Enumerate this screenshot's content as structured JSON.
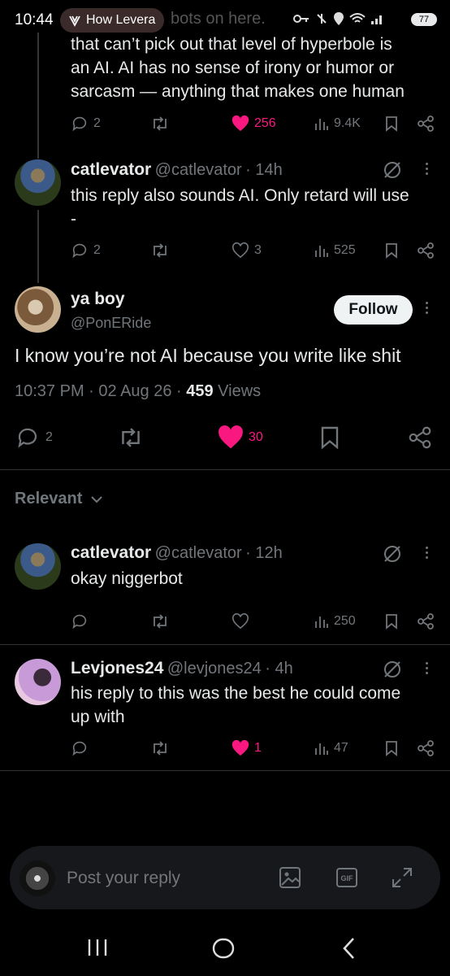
{
  "statusbar": {
    "time": "10:44",
    "app_pill": "How Levera",
    "notif_text": "bots on here.",
    "battery": "77"
  },
  "prev_tweet": {
    "text_lines": [
      "that can’t pick out that level of hyperbole is",
      "an AI. AI has no sense of irony or humor or",
      "sarcasm — anything that makes one human"
    ],
    "replies": "2",
    "likes": "256",
    "views": "9.4K"
  },
  "reply1": {
    "name": "catlevator",
    "handle": "@catlevator",
    "time": "14h",
    "text_lines": [
      "this reply also sounds AI. Only retard will use",
      "-"
    ],
    "replies": "2",
    "likes": "3",
    "views": "525"
  },
  "main": {
    "name": "ya boy",
    "handle": "@PonERide",
    "follow_label": "Follow",
    "text": "I know you’re not AI because you write like shit",
    "timestamp": "10:37 PM · 02 Aug 26 · ",
    "views_count": "459",
    "views_label": " Views",
    "replies": "2",
    "likes": "30"
  },
  "relevant": {
    "label": "Relevant"
  },
  "reply2": {
    "name": "catlevator",
    "handle": "@catlevator",
    "time": "12h",
    "text": "okay niggerbot",
    "views": "250"
  },
  "reply3": {
    "name": "Levjones24",
    "handle": "@levjones24",
    "time": "4h",
    "text_lines": [
      "his reply to this was the best he could come",
      "up with"
    ],
    "likes": "1",
    "views": "47"
  },
  "composer": {
    "placeholder": "Post your reply"
  },
  "colors": {
    "like_pink": "#f91880",
    "muted": "#71767b",
    "bg": "#000000"
  }
}
